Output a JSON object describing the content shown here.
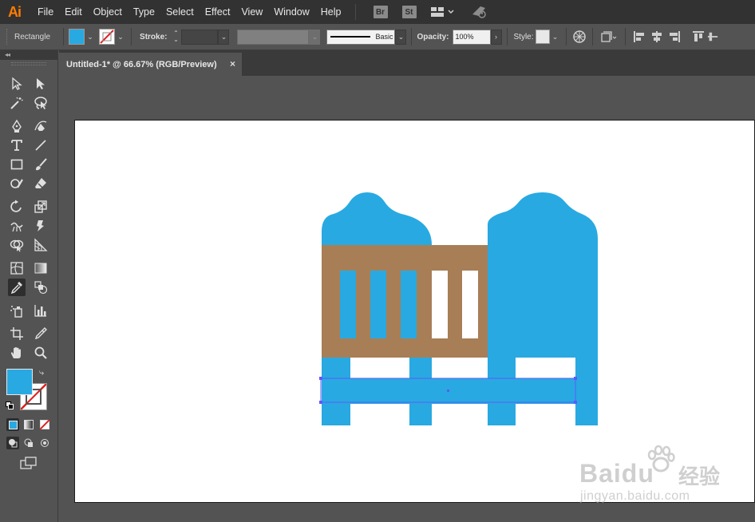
{
  "app": {
    "logo": "Ai",
    "menu": [
      "File",
      "Edit",
      "Object",
      "Type",
      "Select",
      "Effect",
      "View",
      "Window",
      "Help"
    ],
    "bridge_badge": "Br",
    "stock_badge": "St"
  },
  "control_bar": {
    "tool_name": "Rectangle",
    "fill_color": "#29a9e1",
    "stroke_label": "Stroke:",
    "brush_name": "Basic",
    "opacity_label": "Opacity:",
    "opacity_value": "100%",
    "style_label": "Style:"
  },
  "document": {
    "tab_title": "Untitled-1* @ 66.67% (RGB/Preview)",
    "close_glyph": "×"
  },
  "artwork": {
    "colors": {
      "blue": "#29a9e1",
      "brown": "#a87e56",
      "selection": "#5a5aff"
    }
  },
  "watermark": {
    "brand": "Baidu",
    "cn": "经验",
    "url": "jingyan.baidu.com"
  },
  "icons": [
    "selection-icon",
    "direct-selection-icon",
    "magic-wand-icon",
    "lasso-icon",
    "pen-icon",
    "curvature-icon",
    "type-icon",
    "line-icon",
    "rectangle-icon",
    "paintbrush-icon",
    "shaper-icon",
    "eraser-icon",
    "rotate-icon",
    "scale-icon",
    "width-icon",
    "puppet-warp-icon",
    "shape-builder-icon",
    "perspective-grid-icon",
    "mesh-icon",
    "gradient-icon",
    "eyedropper-icon",
    "blend-icon",
    "symbol-sprayer-icon",
    "column-graph-icon",
    "artboard-icon",
    "slice-icon",
    "hand-icon",
    "zoom-icon"
  ]
}
